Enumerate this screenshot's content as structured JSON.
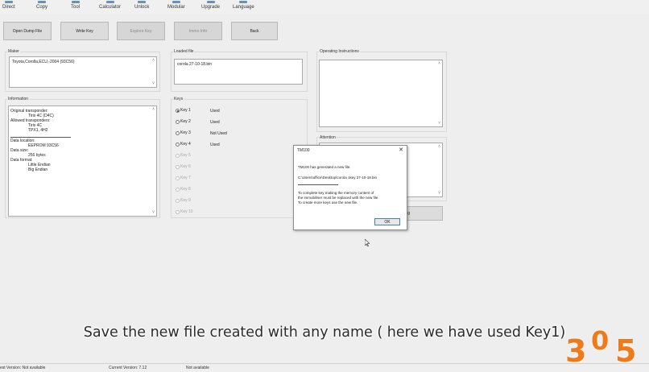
{
  "toolbar": {
    "items": [
      "Direct",
      "Copy",
      "Tool",
      "Calculator",
      "Unlock",
      "Modular",
      "Upgrade",
      "Language"
    ]
  },
  "buttons": {
    "open_dump": "Open Dump File",
    "write_key": "Write Key",
    "explore_key": "Explore Key",
    "immo_info": "Immo Info",
    "back": "Back"
  },
  "maker": {
    "label": "Maker",
    "value": "Toyota,Corolla,ECU,-2004 (93C56)"
  },
  "loaded_file": {
    "label": "Loaded file",
    "value": "corola 27-10-18.bin"
  },
  "operating_instructions": {
    "label": "Operating Instructions"
  },
  "information": {
    "label": "Information",
    "lines": [
      "Original transponder:",
      "Tiris 4C (D4C)",
      "Allowed transponders:",
      "Tiris 4C",
      "TPX1, 4H2",
      "Data location:",
      "EEPROM 93C56",
      "Data size:",
      "256 bytes",
      "Data format:",
      "Little Endian",
      "Big   Endian"
    ]
  },
  "keys": {
    "label": "Keys",
    "items": [
      {
        "name": "Key 1",
        "status": "Used"
      },
      {
        "name": "Key 2",
        "status": "Used"
      },
      {
        "name": "Key 3",
        "status": "Not Used"
      },
      {
        "name": "Key 4",
        "status": "Used"
      },
      {
        "name": "Key 5",
        "status": ""
      },
      {
        "name": "Key 6",
        "status": ""
      },
      {
        "name": "Key 7",
        "status": ""
      },
      {
        "name": "Key 8",
        "status": ""
      },
      {
        "name": "Key 9",
        "status": ""
      },
      {
        "name": "Key 10",
        "status": ""
      }
    ]
  },
  "attention": {
    "label": "Attention",
    "button_tail": "g"
  },
  "dialog": {
    "title": "TM100",
    "close": "✕",
    "line1": "TM100 has generated a new file.",
    "line2": "C:\\Users\\office\\Desktop\\corola 1key 27-10-18.bin",
    "line3": "To complete key making the memory content of",
    "line4": "the immobiliser must be replaced with the new file.",
    "line5": "To create more keys use the new file.",
    "ok": "OK"
  },
  "subtitle": "Save the new file created with any name ( here we have used Key1)",
  "statusbar": {
    "last_version": "est Version: Not available",
    "current_version": "Current Version: 7.12",
    "status": "Not available"
  },
  "logo": {
    "text1": "3",
    "text2": "0",
    "text3": "5"
  },
  "colors": {
    "logo_orange": "#f07a1a",
    "ok_border": "#3c7fd8"
  }
}
